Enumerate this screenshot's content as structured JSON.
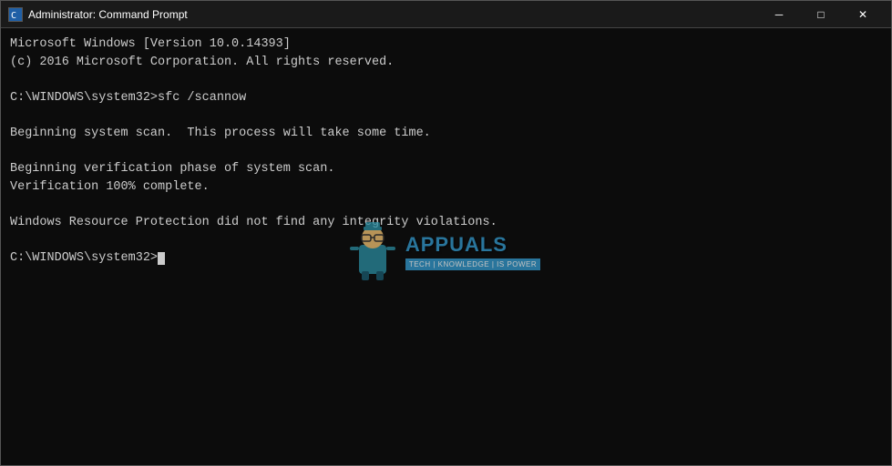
{
  "window": {
    "title": "Administrator: Command Prompt",
    "icon_label": "cmd-icon"
  },
  "titlebar": {
    "minimize_label": "─",
    "maximize_label": "□",
    "close_label": "✕"
  },
  "console": {
    "lines": [
      "Microsoft Windows [Version 10.0.14393]",
      "(c) 2016 Microsoft Corporation. All rights reserved.",
      "",
      "C:\\WINDOWS\\system32>sfc /scannow",
      "",
      "Beginning system scan.  This process will take some time.",
      "",
      "Beginning verification phase of system scan.",
      "Verification 100% complete.",
      "",
      "Windows Resource Protection did not find any integrity violations.",
      "",
      "C:\\WINDOWS\\system32>"
    ]
  },
  "watermark": {
    "site": "APPUALS",
    "tagline": "TECH | KNOWLEDGE | IS POWER"
  }
}
